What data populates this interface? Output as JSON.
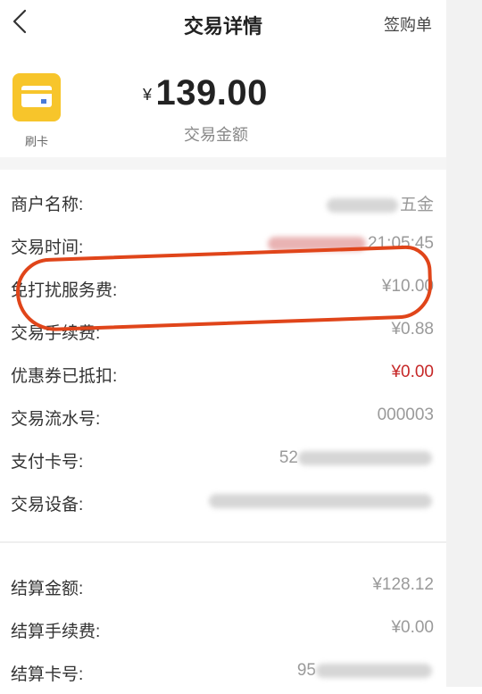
{
  "nav": {
    "title": "交易详情",
    "action": "签购单"
  },
  "header": {
    "card_label": "刷卡",
    "currency": "¥",
    "amount": "139.00",
    "amount_label": "交易金额"
  },
  "details": [
    {
      "label": "商户名称:",
      "value": "五金",
      "style": "partial"
    },
    {
      "label": "交易时间:",
      "value": "21:05:45",
      "style": "partial"
    },
    {
      "label": "免打扰服务费:",
      "value": "¥10.00",
      "style": "plain"
    },
    {
      "label": "交易手续费:",
      "value": "¥0.88",
      "style": "plain"
    },
    {
      "label": "优惠券已抵扣:",
      "value": "¥0.00",
      "style": "red"
    },
    {
      "label": "交易流水号:",
      "value": "000003",
      "style": "plain"
    },
    {
      "label": "支付卡号:",
      "value": "52",
      "style": "partial"
    },
    {
      "label": "交易设备:",
      "value": "",
      "style": "hidden"
    }
  ],
  "settlement": [
    {
      "label": "结算金额:",
      "value": "¥128.12",
      "style": "plain"
    },
    {
      "label": "结算手续费:",
      "value": "¥0.00",
      "style": "plain"
    },
    {
      "label": "结算卡号:",
      "value": "95",
      "style": "partial"
    }
  ],
  "colors": {
    "card_yellow": "#f7c52b",
    "annotation_red": "#e0451a",
    "coupon_red": "#c62828"
  }
}
